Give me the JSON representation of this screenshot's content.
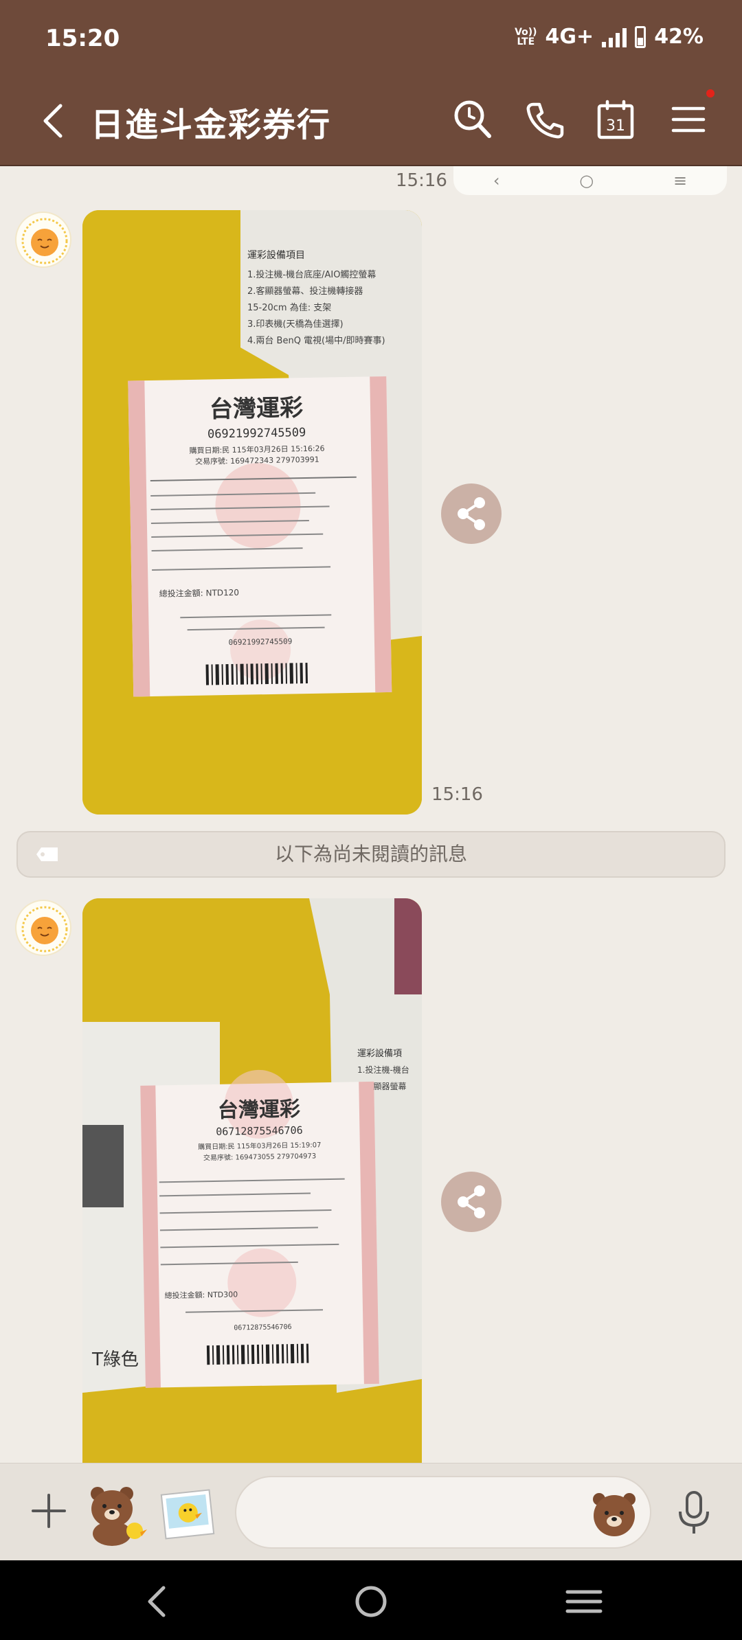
{
  "status_bar": {
    "time": "15:20",
    "volte_line1": "Vo))",
    "volte_line2": "LTE",
    "network": "4G+",
    "battery": "42%"
  },
  "header": {
    "title": "日進斗金彩券行",
    "icons": [
      "back-icon",
      "search-icon",
      "phone-icon",
      "calendar-icon",
      "menu-icon"
    ],
    "calendar_day": "31",
    "notification_dot_color": "#e2231a"
  },
  "chat": {
    "messages": [
      {
        "sender": "sun-avatar",
        "type": "image",
        "image_label": "彩券照片",
        "timestamp": "15:16"
      },
      {
        "sender": "sun-avatar",
        "type": "image",
        "image_label": "彩券照片",
        "timestamp": ""
      }
    ],
    "previous_timestamp": "15:16",
    "unread_divider": "以下為尚未閱讀的訊息",
    "ticket_1": {
      "brand": "台灣運彩",
      "serial": "06921992745509",
      "purchase_line": "購買日期:民 115年03月26日 15:16:26",
      "trade_line": "交易序號: 169472343 279703991",
      "total_line": "總投注金額: NTD120",
      "barcode_serial": "06921992745509"
    },
    "ticket_2": {
      "brand": "台灣運彩",
      "serial": "06712875546706",
      "purchase_line": "購買日期:民 115年03月26日 15:19:07",
      "trade_line": "交易序號: 169473055 279704973",
      "total_line": "總投注金額: NTD300",
      "barcode_serial": "06712875546706"
    }
  },
  "input_bar": {
    "placeholder": "",
    "icons": [
      "plus-icon",
      "sticker-icon",
      "photo-icon",
      "emoji-icon",
      "mic-icon"
    ]
  },
  "colors": {
    "header_bg": "#6e4a3a",
    "chat_bg": "#f0ece6",
    "share_bg": "#cbb1a6"
  }
}
